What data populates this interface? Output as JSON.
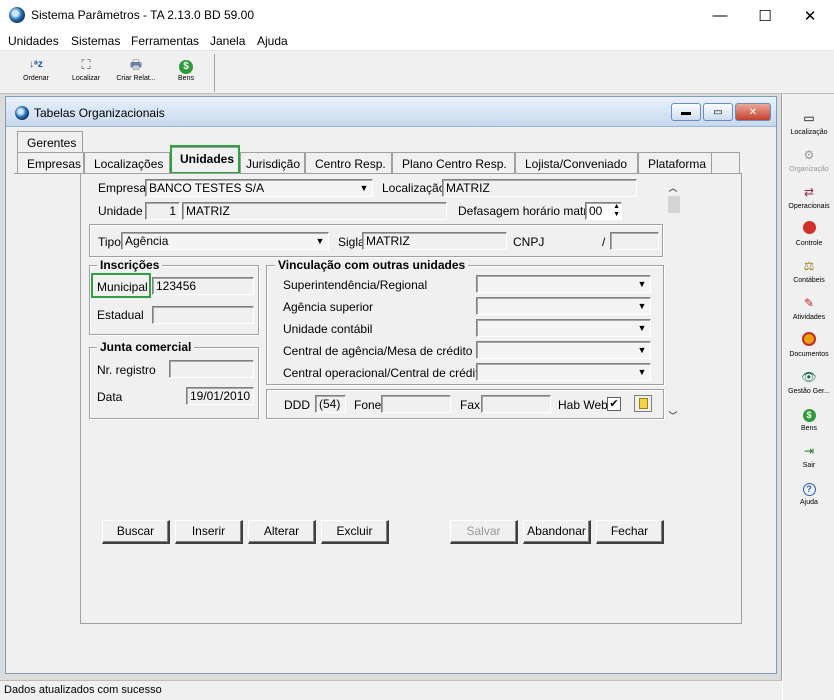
{
  "app": {
    "title": "Sistema Parâmetros -   TA 2.13.0 BD 59.00",
    "caption_minimize": "—",
    "caption_maximize": "☐",
    "caption_close": "✕"
  },
  "menu": [
    "Unidades",
    "Sistemas",
    "Ferramentas",
    "Janela",
    "Ajuda"
  ],
  "toolbar": [
    {
      "label": "Ordenar",
      "icon": "sort-az-icon"
    },
    {
      "label": "Localizar",
      "icon": "find-icon"
    },
    {
      "label": "Criar Relat...",
      "icon": "printer-icon"
    },
    {
      "label": "Bens",
      "icon": "money-bag-icon"
    }
  ],
  "sidebar": [
    {
      "label": "Localização",
      "icon": "location-icon"
    },
    {
      "label": "Organização",
      "icon": "organization-icon",
      "disabled": true
    },
    {
      "label": "Operacionais",
      "icon": "operations-icon"
    },
    {
      "label": "Controle",
      "icon": "stop-icon"
    },
    {
      "label": "Contábeis",
      "icon": "scales-icon"
    },
    {
      "label": "Atividades",
      "icon": "activities-icon"
    },
    {
      "label": "Documentos",
      "icon": "documents-icon"
    },
    {
      "label": "Gestão Ger...",
      "icon": "management-icon"
    },
    {
      "label": "Bens",
      "icon": "money-bag-icon"
    },
    {
      "label": "Sair",
      "icon": "exit-icon"
    },
    {
      "label": "Ajuda",
      "icon": "help-icon"
    }
  ],
  "window": {
    "title": "Tabelas Organizacionais",
    "tabs_row1": [
      "Gerentes"
    ],
    "tabs_row2": [
      "Empresas",
      "Localizações",
      "Unidades",
      "Jurisdição",
      "Centro Resp.",
      "Plano Centro Resp.",
      "Lojista/Conveniado",
      "Plataforma"
    ],
    "active_tab": "Unidades"
  },
  "form": {
    "empresa_label": "Empresa",
    "empresa_value": "BANCO TESTES S/A",
    "localizacao_label": "Localização",
    "localizacao_value": "MATRIZ",
    "unidade_label": "Unidade",
    "unidade_code": "1",
    "unidade_name": "MATRIZ",
    "defasagem_label": "Defasagem horário matriz",
    "defasagem_value": "00",
    "tipo_label": "Tipo",
    "tipo_value": "Agência",
    "sigla_label": "Sigla",
    "sigla_value": "MATRIZ",
    "cnpj_label": "CNPJ",
    "cnpj_separator": "/",
    "inscricoes_title": "Inscrições",
    "municipal_label": "Municipal",
    "municipal_value": "123456",
    "estadual_label": "Estadual",
    "estadual_value": "",
    "junta_title": "Junta comercial",
    "nr_registro_label": "Nr. registro",
    "nr_registro_value": "",
    "data_label": "Data",
    "data_value": "19/01/2010",
    "vinculacao_title": "Vinculação com outras unidades",
    "vinculacao_rows": [
      "Superintendência/Regional",
      "Agência superior",
      "Unidade contábil",
      "Central de agência/Mesa de crédito",
      "Central operacional/Central de crédito"
    ],
    "ddd_label": "DDD",
    "ddd_value": "(54)",
    "fone_label": "Fone",
    "fax_label": "Fax",
    "hab_web_label": "Hab Web",
    "hab_web_checked": true
  },
  "buttons": {
    "buscar": "Buscar",
    "inserir": "Inserir",
    "alterar": "Alterar",
    "excluir": "Excluir",
    "salvar": "Salvar",
    "abandonar": "Abandonar",
    "fechar": "Fechar"
  },
  "status": "Dados atualizados com sucesso",
  "colors": {
    "highlight": "#2ea043",
    "accent": "#2a6fb0"
  }
}
